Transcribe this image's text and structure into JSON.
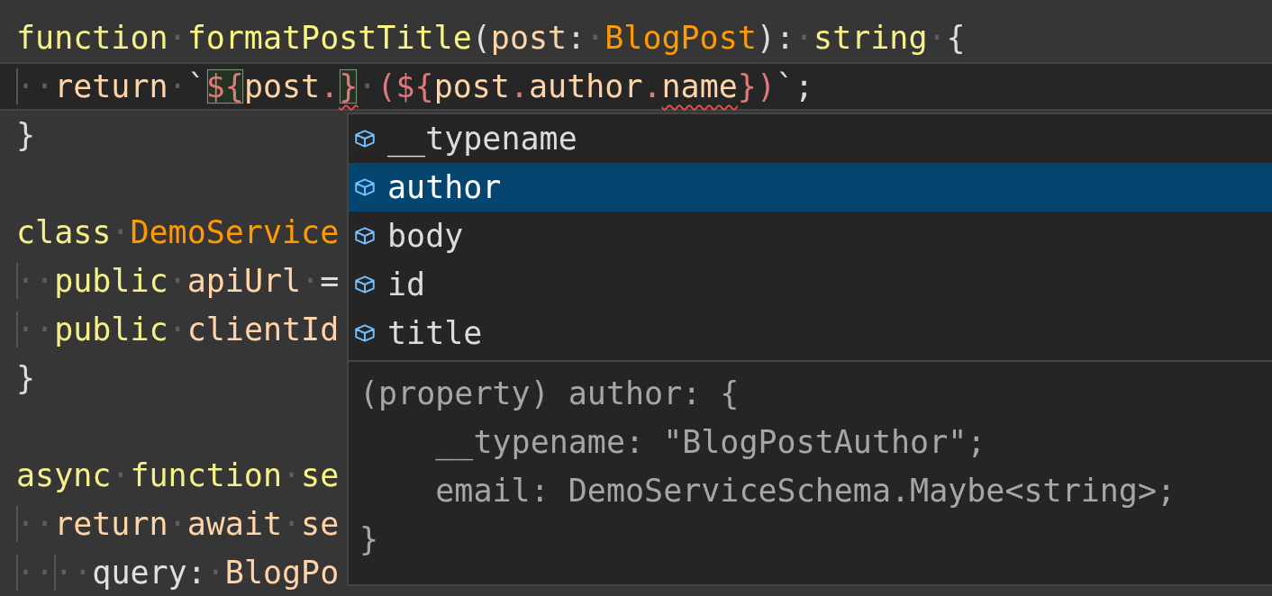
{
  "editor": {
    "lines": [
      {
        "tokens": [
          {
            "kind": "keyword",
            "text": "function"
          },
          {
            "kind": "ws",
            "text": "·"
          },
          {
            "kind": "function",
            "text": "formatPostTitle"
          },
          {
            "kind": "punct",
            "text": "("
          },
          {
            "kind": "variable",
            "text": "post"
          },
          {
            "kind": "punct",
            "text": ":"
          },
          {
            "kind": "ws",
            "text": "·"
          },
          {
            "kind": "type",
            "text": "BlogPost"
          },
          {
            "kind": "punct",
            "text": "):"
          },
          {
            "kind": "ws",
            "text": "·"
          },
          {
            "kind": "keyword",
            "text": "string"
          },
          {
            "kind": "ws",
            "text": "·"
          },
          {
            "kind": "punct",
            "text": "{"
          }
        ]
      },
      {
        "current": true,
        "tokens": [
          {
            "kind": "ws",
            "text": "··",
            "guide": true
          },
          {
            "kind": "variable",
            "text": "return"
          },
          {
            "kind": "ws",
            "text": "·"
          },
          {
            "kind": "punct",
            "text": "`"
          },
          {
            "kind": "template",
            "text": "${",
            "matched": true
          },
          {
            "kind": "variable",
            "text": "post"
          },
          {
            "kind": "template",
            "text": "."
          },
          {
            "kind": "template",
            "text": "}",
            "matched": true,
            "error": true
          },
          {
            "kind": "ws",
            "text": "·"
          },
          {
            "kind": "template",
            "text": "(${"
          },
          {
            "kind": "variable",
            "text": "post"
          },
          {
            "kind": "template",
            "text": "."
          },
          {
            "kind": "variable",
            "text": "author"
          },
          {
            "kind": "template",
            "text": "."
          },
          {
            "kind": "variable",
            "text": "name",
            "error": true
          },
          {
            "kind": "template",
            "text": "})"
          },
          {
            "kind": "punct",
            "text": "`;"
          }
        ]
      },
      {
        "tokens": [
          {
            "kind": "punct",
            "text": "}"
          }
        ]
      },
      {
        "kind": "blank"
      },
      {
        "tokens": [
          {
            "kind": "keyword",
            "text": "class"
          },
          {
            "kind": "ws",
            "text": "·"
          },
          {
            "kind": "type",
            "text": "DemoService"
          }
        ]
      },
      {
        "tokens": [
          {
            "kind": "ws",
            "text": "··",
            "guide": true
          },
          {
            "kind": "keyword",
            "text": "public"
          },
          {
            "kind": "ws",
            "text": "·"
          },
          {
            "kind": "variable",
            "text": "apiUrl"
          },
          {
            "kind": "ws",
            "text": "·"
          },
          {
            "kind": "punct",
            "text": "="
          }
        ]
      },
      {
        "tokens": [
          {
            "kind": "ws",
            "text": "··",
            "guide": true
          },
          {
            "kind": "keyword",
            "text": "public"
          },
          {
            "kind": "ws",
            "text": "·"
          },
          {
            "kind": "variable",
            "text": "clientId"
          }
        ]
      },
      {
        "tokens": [
          {
            "kind": "punct",
            "text": "}"
          }
        ]
      },
      {
        "kind": "blank"
      },
      {
        "tokens": [
          {
            "kind": "keyword",
            "text": "async"
          },
          {
            "kind": "ws",
            "text": "·"
          },
          {
            "kind": "keyword",
            "text": "function"
          },
          {
            "kind": "ws",
            "text": "·"
          },
          {
            "kind": "function",
            "text": "se"
          }
        ]
      },
      {
        "tokens": [
          {
            "kind": "ws",
            "text": "··",
            "guide": true
          },
          {
            "kind": "variable",
            "text": "return"
          },
          {
            "kind": "ws",
            "text": "·"
          },
          {
            "kind": "variable",
            "text": "await"
          },
          {
            "kind": "ws",
            "text": "·"
          },
          {
            "kind": "variable",
            "text": "se"
          }
        ]
      },
      {
        "tokens": [
          {
            "kind": "ws",
            "text": "··",
            "guide": true
          },
          {
            "kind": "ws",
            "text": "··",
            "guide": true
          },
          {
            "kind": "plain",
            "text": "query"
          },
          {
            "kind": "punct",
            "text": ":"
          },
          {
            "kind": "ws",
            "text": "·"
          },
          {
            "kind": "variable",
            "text": "BlogPo"
          }
        ]
      }
    ]
  },
  "suggestions": {
    "items": [
      {
        "label": "__typename",
        "selected": false
      },
      {
        "label": "author",
        "selected": true
      },
      {
        "label": "body",
        "selected": false
      },
      {
        "label": "id",
        "selected": false
      },
      {
        "label": "title",
        "selected": false
      }
    ],
    "detail": [
      "(property) author: {",
      "    __typename: \"BlogPostAuthor\";",
      "    email: DemoServiceSchema.Maybe<string>;",
      "}"
    ]
  }
}
